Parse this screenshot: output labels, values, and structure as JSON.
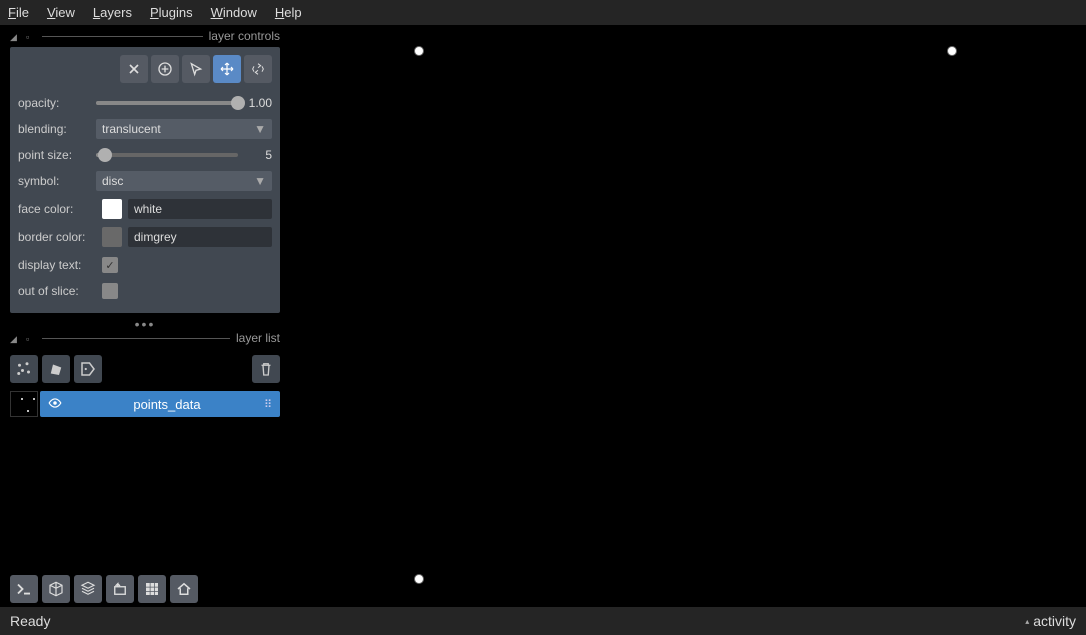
{
  "menu": [
    "File",
    "View",
    "Layers",
    "Plugins",
    "Window",
    "Help"
  ],
  "panels": {
    "controls_title": "layer controls",
    "list_title": "layer list"
  },
  "tools": {
    "delete": "delete-points",
    "add": "add-points",
    "select": "select-points",
    "pan_zoom": "pan-zoom",
    "transform": "transform"
  },
  "props": {
    "opacity_label": "opacity:",
    "opacity_value": "1.00",
    "opacity_percent": 100,
    "blending_label": "blending:",
    "blending_value": "translucent",
    "pointsize_label": "point size:",
    "pointsize_value": "5",
    "pointsize_percent": 6,
    "symbol_label": "symbol:",
    "symbol_value": "disc",
    "facecolor_label": "face color:",
    "facecolor_value": "white",
    "bordercolor_label": "border color:",
    "bordercolor_value": "dimgrey",
    "displaytext_label": "display text:",
    "displaytext_checked": true,
    "outofslice_label": "out of slice:",
    "outofslice_checked": false
  },
  "layer_buttons": {
    "new_points": "new-points-layer",
    "new_shapes": "new-shapes-layer",
    "new_labels": "new-labels-layer",
    "delete": "delete-layer"
  },
  "layers": [
    {
      "name": "points_data",
      "visible": true,
      "selected": true
    }
  ],
  "viewer_buttons": {
    "console": "toggle-console",
    "ndisplay": "toggle-ndisplay",
    "roll": "roll-dims",
    "transpose": "transpose-dims",
    "grid": "toggle-grid",
    "home": "reset-view"
  },
  "canvas_points": [
    {
      "x": 16.3,
      "y": 3.5
    },
    {
      "x": 83.8,
      "y": 3.5
    },
    {
      "x": 16.3,
      "y": 96.5
    }
  ],
  "status": {
    "left": "Ready",
    "right": "activity"
  }
}
